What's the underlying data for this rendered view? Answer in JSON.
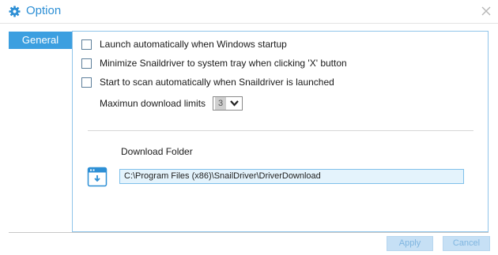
{
  "window": {
    "title": "Option",
    "title_icon": "gear-icon",
    "close_icon": "close-icon",
    "accent_color": "#2d8fd5"
  },
  "tabs": [
    {
      "label": "General",
      "active": true
    }
  ],
  "options": [
    {
      "label": "Launch automatically when Windows startup",
      "checked": false
    },
    {
      "label": "Minimize Snaildriver to system tray when clicking 'X' button",
      "checked": false
    },
    {
      "label": "Start to scan automatically when Snaildriver is launched",
      "checked": false
    }
  ],
  "download_limit": {
    "label": "Maximun download limits",
    "value": "3"
  },
  "download_folder": {
    "title": "Download Folder",
    "icon": "folder-browse-icon",
    "path": "C:\\Program Files (x86)\\SnailDriver\\DriverDownload"
  },
  "buttons": {
    "apply": "Apply",
    "cancel": "Cancel"
  }
}
